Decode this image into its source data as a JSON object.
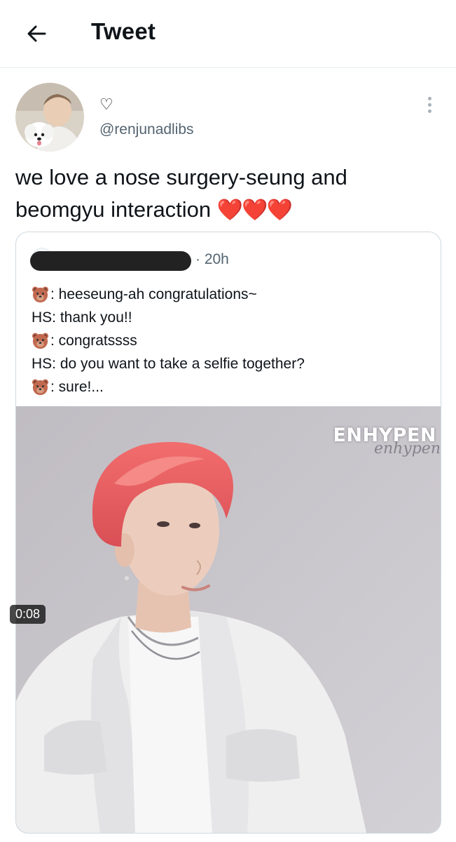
{
  "header": {
    "title": "Tweet",
    "back_icon": "arrow-left-icon"
  },
  "author": {
    "display_name": "♡",
    "handle": "@renjunadlibs"
  },
  "tweet": {
    "text": "we love a nose surgery-seung and beomgyu interaction",
    "hearts": "❤️❤️❤️"
  },
  "quoted": {
    "time": "· 20h",
    "lines": [
      {
        "bear": true,
        "text": ": heeseung-ah congratulations~"
      },
      {
        "bear": false,
        "text": "HS: thank you!!"
      },
      {
        "bear": true,
        "text": ": congratssss"
      },
      {
        "bear": false,
        "text": "HS: do you want to take a selfie together?"
      },
      {
        "bear": true,
        "text": ": sure!..."
      }
    ],
    "media": {
      "watermark": "ENHYPEN",
      "watermark_script": "enhypen",
      "duration": "0:08"
    }
  },
  "colors": {
    "heart": "#dd2e44",
    "secondary_text": "#536471",
    "border": "#cfd9de"
  }
}
